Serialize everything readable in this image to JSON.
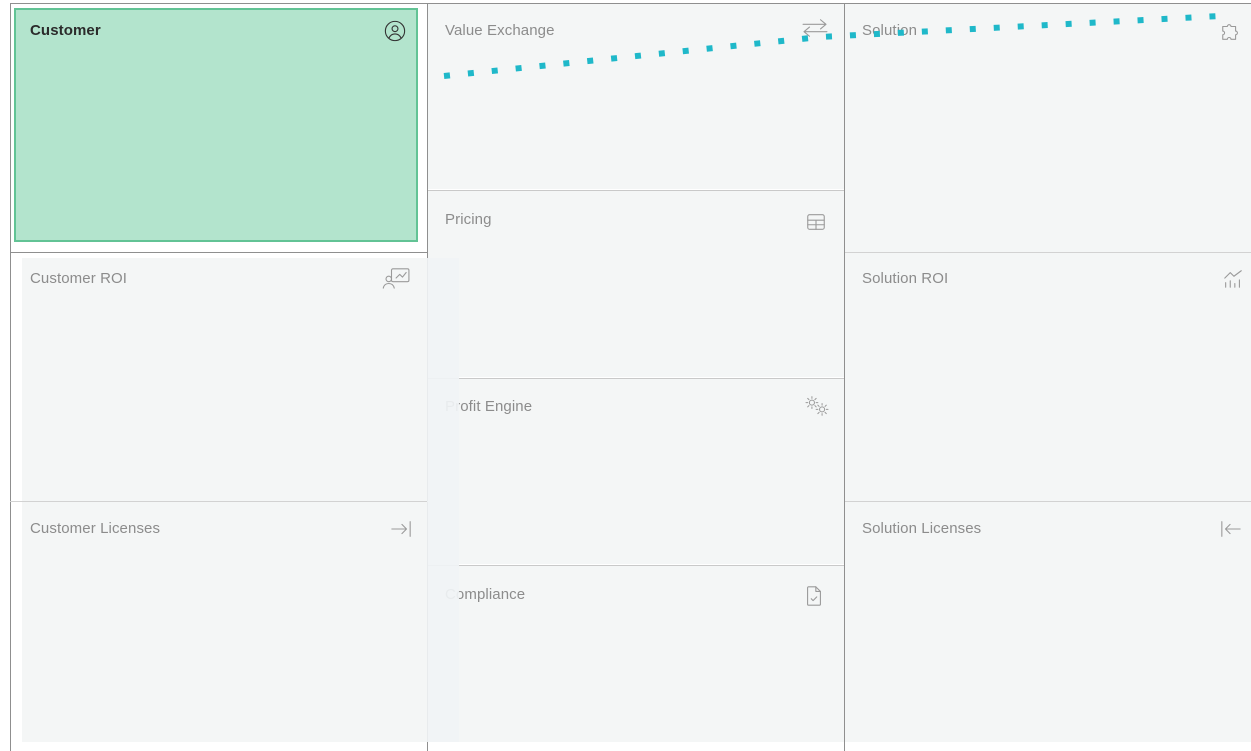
{
  "canvas": {
    "panels": {
      "customer": {
        "title": "Customer",
        "icon": "user-circle-icon"
      },
      "value_exchange": {
        "title": "Value Exchange",
        "icon": "swap-arrows-icon"
      },
      "solution": {
        "title": "Solution",
        "icon": "puzzle-icon"
      },
      "pricing": {
        "title": "Pricing",
        "icon": "table-icon"
      },
      "customer_roi": {
        "title": "Customer ROI",
        "icon": "presentation-user-icon"
      },
      "solution_roi": {
        "title": "Solution ROI",
        "icon": "bar-chart-trend-icon"
      },
      "profit_engine": {
        "title": "Profit Engine",
        "icon": "gears-icon"
      },
      "customer_licenses": {
        "title": "Customer Licenses",
        "icon": "arrow-right-to-bar-icon"
      },
      "solution_licenses": {
        "title": "Solution Licenses",
        "icon": "arrow-left-from-bar-icon"
      },
      "compliance": {
        "title": "Compliance",
        "icon": "document-check-icon"
      }
    }
  },
  "colors": {
    "active_fill": "#b3e4cd",
    "active_border": "#62c395",
    "panel_fill": "#f4f6f6",
    "connector": "#1fb8c9"
  }
}
